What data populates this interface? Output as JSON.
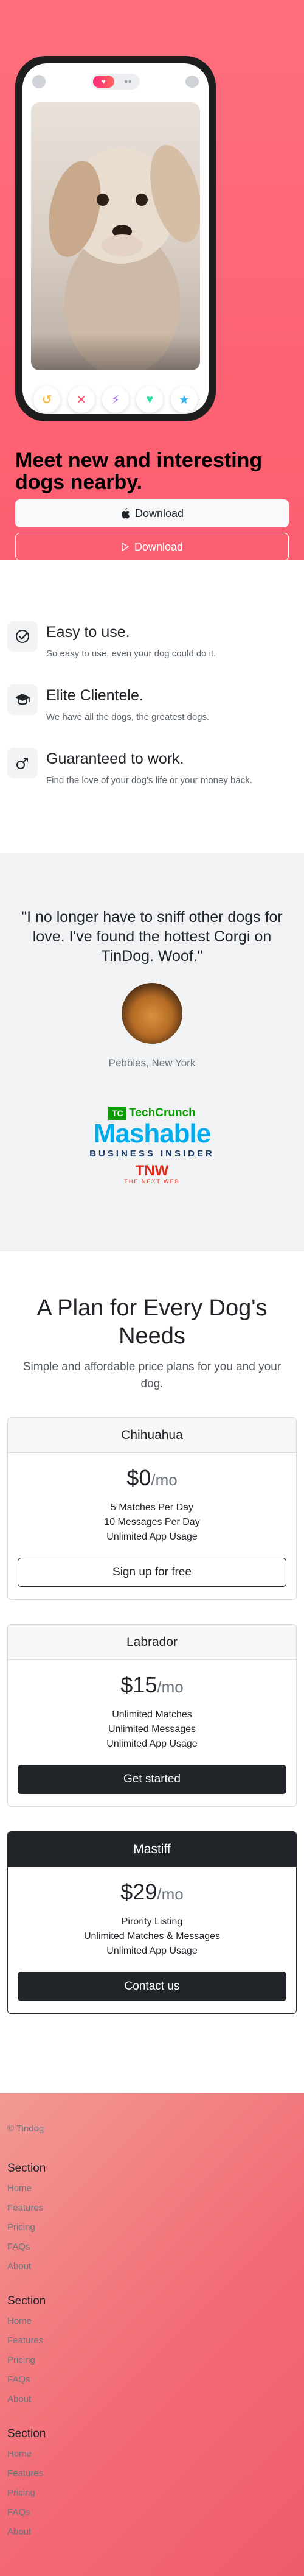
{
  "hero": {
    "app_toggle": {
      "active_label": "",
      "inactive_label": ""
    },
    "title": "Meet new and interesting dogs nearby.",
    "download_apple_label": "Download",
    "download_play_label": "Download"
  },
  "features": [
    {
      "icon": "check-circle-icon",
      "title": "Easy to use.",
      "text": "So easy to use, even your dog could do it."
    },
    {
      "icon": "graduation-cap-icon",
      "title": "Elite Clientele.",
      "text": "We have all the dogs, the greatest dogs."
    },
    {
      "icon": "heart-icon",
      "title": "Guaranteed to work.",
      "text": "Find the love of your dog's life or your money back."
    }
  ],
  "testimonial": {
    "quote": "\"I no longer have to sniff other dogs for love. I've found the hottest Corgi on TinDog. Woof.\"",
    "author": "Pebbles, New York"
  },
  "press": {
    "techcrunch": "TechCrunch",
    "techcrunch_mark": "TC",
    "mashable": "Mashable",
    "business_insider": "BUSINESS INSIDER",
    "tnw": "TNW",
    "tnw_tagline": "THE NEXT WEB"
  },
  "pricing": {
    "title": "A Plan for Every Dog's Needs",
    "lead": "Simple and affordable price plans for you and your dog.",
    "plans": [
      {
        "name": "Chihuahua",
        "price": "$0",
        "period": "/mo",
        "features": [
          "5 Matches Per Day",
          "10 Messages Per Day",
          "Unlimited App Usage"
        ],
        "button": "Sign up for free"
      },
      {
        "name": "Labrador",
        "price": "$15",
        "period": "/mo",
        "features": [
          "Unlimited Matches",
          "Unlimited Messages",
          "Unlimited App Usage"
        ],
        "button": "Get started"
      },
      {
        "name": "Mastiff",
        "price": "$29",
        "period": "/mo",
        "features": [
          "Pirority Listing",
          "Unlimited Matches & Messages",
          "Unlimited App Usage"
        ],
        "button": "Contact us"
      }
    ]
  },
  "footer": {
    "copyright": "© Tindog",
    "columns": [
      {
        "heading": "Section",
        "links": [
          "Home",
          "Features",
          "Pricing",
          "FAQs",
          "About"
        ]
      },
      {
        "heading": "Section",
        "links": [
          "Home",
          "Features",
          "Pricing",
          "FAQs",
          "About"
        ]
      },
      {
        "heading": "Section",
        "links": [
          "Home",
          "Features",
          "Pricing",
          "FAQs",
          "About"
        ]
      }
    ]
  },
  "colors": {
    "brand": "#fb5e70",
    "dark": "#212529",
    "muted": "#6c757d"
  }
}
